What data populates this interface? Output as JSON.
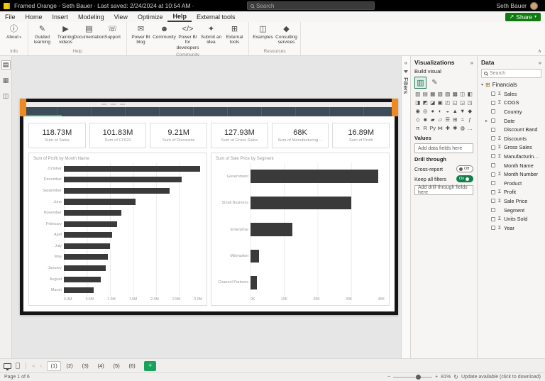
{
  "theme": {
    "titlebar-black": "#000000",
    "accent-orange": "#ee8a21",
    "frame-black": "#141414",
    "navbar-slate": "#3d4c59",
    "indicator-green": "#2fb457",
    "share-green": "#0f7b0f",
    "toggle-on-green": "#11804d",
    "page-add-green": "#17a35b"
  },
  "titlebar": {
    "app_title": "Framed Orange - Seth Bauer ∙ Last saved: 2/24/2024 at 10:54 AM ∙",
    "search_placeholder": "Search",
    "user_name": "Seth Bauer"
  },
  "menubar": {
    "items": [
      {
        "label": "File",
        "dn": "menu-file"
      },
      {
        "label": "Home",
        "dn": "menu-home"
      },
      {
        "label": "Insert",
        "dn": "menu-insert"
      },
      {
        "label": "Modeling",
        "dn": "menu-modeling"
      },
      {
        "label": "View",
        "dn": "menu-view"
      },
      {
        "label": "Optimize",
        "dn": "menu-optimize"
      },
      {
        "label": "Help",
        "dn": "menu-help",
        "active": true
      },
      {
        "label": "External tools",
        "dn": "menu-external-tools"
      }
    ],
    "share_label": "Share"
  },
  "ribbon": {
    "groups": {
      "info": {
        "label": "Info",
        "buttons": [
          {
            "label": "About",
            "glyph": "ⓘ",
            "dn": "about-button",
            "dropdown": true
          }
        ]
      },
      "help": {
        "label": "Help",
        "buttons": [
          {
            "label": "Guided learning",
            "glyph": "✎",
            "dn": "guided-learning-button"
          },
          {
            "label": "Training videos",
            "glyph": "▶",
            "dn": "training-videos-button"
          },
          {
            "label": "Documentation",
            "glyph": "▤",
            "dn": "documentation-button"
          },
          {
            "label": "Support",
            "glyph": "☏",
            "dn": "support-button"
          }
        ]
      },
      "community": {
        "label": "Community",
        "buttons": [
          {
            "label": "Power BI blog",
            "glyph": "✉",
            "dn": "power-bi-blog-button"
          },
          {
            "label": "Community",
            "glyph": "☻",
            "dn": "community-button"
          },
          {
            "label": "Power BI for developers",
            "glyph": "</>",
            "dn": "power-bi-for-developers-button"
          },
          {
            "label": "Submit an idea",
            "glyph": "✦",
            "dn": "submit-an-idea-button"
          },
          {
            "label": "External tools",
            "glyph": "⊞",
            "dn": "external-tools-button"
          }
        ]
      },
      "resources": {
        "label": "Resources",
        "buttons": [
          {
            "label": "Examples",
            "glyph": "◫",
            "dn": "examples-button"
          },
          {
            "label": "Consulting services",
            "glyph": "◆",
            "dn": "consulting-services-button"
          }
        ]
      }
    }
  },
  "view_rail": {
    "items": [
      {
        "glyph": "▤",
        "dn": "report-view-icon",
        "active": true
      },
      {
        "glyph": "▦",
        "dn": "table-view-icon"
      },
      {
        "glyph": "◫",
        "dn": "model-view-icon"
      }
    ]
  },
  "report": {
    "cards": [
      {
        "value": "118.73M",
        "label": "Sum of Sales"
      },
      {
        "value": "101.83M",
        "label": "Sum of COGS"
      },
      {
        "value": "9.21M",
        "label": "Sum of Discounts"
      },
      {
        "value": "127.93M",
        "label": "Sum of Gross Sales"
      },
      {
        "value": "68K",
        "label": "Sum of Manufacturing ..."
      },
      {
        "value": "16.89M",
        "label": "Sum of Profit"
      }
    ]
  },
  "chart_data": [
    {
      "type": "bar",
      "orientation": "horizontal",
      "title": "Sum of Profit by Month Name",
      "categories": [
        "October",
        "December",
        "September",
        "June",
        "November",
        "February",
        "April",
        "July",
        "May",
        "January",
        "August",
        "March"
      ],
      "values": [
        2.95,
        2.55,
        2.3,
        1.55,
        1.25,
        1.15,
        1.05,
        1.0,
        0.95,
        0.9,
        0.8,
        0.65
      ],
      "unit": "M",
      "xlim": [
        0,
        3
      ],
      "x_ticks": [
        "0.0M",
        "0.5M",
        "1.0M",
        "1.5M",
        "2.0M",
        "2.5M",
        "3.0M"
      ],
      "bar_color": "#3a3a3a",
      "grid": true,
      "xlabel": "",
      "ylabel": ""
    },
    {
      "type": "bar",
      "orientation": "horizontal",
      "title": "Sum of Sale Price by Segment",
      "categories": [
        "Government",
        "Small Business",
        "Enterprise",
        "Midmarket",
        "Channel Partners"
      ],
      "values": [
        38,
        30,
        12.5,
        2.5,
        2
      ],
      "unit": "K",
      "xlim": [
        0,
        40
      ],
      "x_ticks": [
        "0K",
        "10K",
        "20K",
        "30K",
        "40K"
      ],
      "bar_color": "#3a3a3a",
      "grid": true,
      "xlabel": "",
      "ylabel": ""
    }
  ],
  "filters_panel": {
    "title": "Filters"
  },
  "visualizations_panel": {
    "title": "Visualizations",
    "build_visual_label": "Build visual",
    "visual_icons": [
      "▥",
      "▤",
      "▦",
      "▧",
      "▨",
      "▩",
      "◫",
      "◧",
      "◨",
      "◩",
      "◪",
      "▣",
      "◰",
      "◱",
      "◲",
      "◳",
      "◉",
      "◎",
      "●",
      "◐",
      "◒",
      "▲",
      "▼",
      "◆",
      "◇",
      "■",
      "▰",
      "▱",
      "☰",
      "⊞",
      "≈",
      "ƒ",
      "π",
      "R",
      "Py",
      "⋈",
      "✚",
      "✱",
      "◍",
      "…"
    ],
    "values_label": "Values",
    "values_placeholder": "Add data fields here",
    "drill_through_label": "Drill through",
    "cross_report_label": "Cross-report",
    "cross_report_state": "Off",
    "keep_filters_label": "Keep all filters",
    "keep_filters_state": "On",
    "drill_placeholder": "Add drill-through fields here"
  },
  "data_panel": {
    "title": "Data",
    "search_placeholder": "Search",
    "sigma_glyph": "Σ",
    "expand_glyph": "▸",
    "table": {
      "name": "Financials"
    },
    "fields": [
      {
        "name": "Sales",
        "numeric": true
      },
      {
        "name": "COGS",
        "numeric": true
      },
      {
        "name": "Country"
      },
      {
        "name": "Date",
        "expandable": true
      },
      {
        "name": "Discount Band"
      },
      {
        "name": "Discounts",
        "numeric": true
      },
      {
        "name": "Gross Sales",
        "numeric": true
      },
      {
        "name": "Manufacturing P...",
        "numeric": true
      },
      {
        "name": "Month Name"
      },
      {
        "name": "Month Number",
        "numeric": true
      },
      {
        "name": "Product"
      },
      {
        "name": "Profit",
        "numeric": true
      },
      {
        "name": "Sale Price",
        "numeric": true
      },
      {
        "name": "Segment"
      },
      {
        "name": "Units Sold",
        "numeric": true
      },
      {
        "name": "Year",
        "numeric": true
      }
    ]
  },
  "page_tabs": {
    "pages": [
      {
        "label": "(1)",
        "active": true
      },
      {
        "label": "(2)"
      },
      {
        "label": "(3)"
      },
      {
        "label": "(4)"
      },
      {
        "label": "(5)"
      },
      {
        "label": "(6)"
      }
    ],
    "add_label": "+"
  },
  "status_bar": {
    "left": "Page 1 of 6",
    "zoom": "81%",
    "update_text": "Update available (click to download)"
  }
}
